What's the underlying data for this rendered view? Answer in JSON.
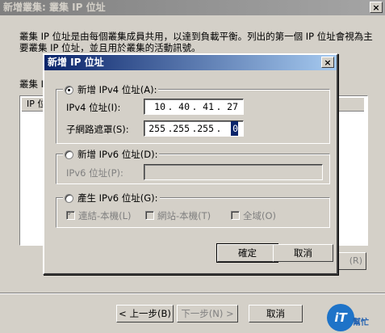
{
  "wizard": {
    "title": "新增叢集: 叢集 IP 位址",
    "close": "×",
    "description": "叢集 IP 位址是由每個叢集成員共用，以達到負載平衡。列出的第一個 IP 位址會視為主要叢集 IP 位址，並且用於叢集的活動訊號。",
    "list_label": "叢集 IP 位址(",
    "list_header": "IP 位",
    "side_button": "(R)",
    "buttons": {
      "back": "< 上一步(B)",
      "next": "下一步(N) >",
      "cancel": "取消"
    },
    "watermark": {
      "logo": "iT",
      "text": "幫忙"
    }
  },
  "dialog": {
    "title": "新增 IP 位址",
    "close": "×",
    "ipv4_group": {
      "legend": "新增 IPv4 位址(A):",
      "selected": true,
      "ip_label": "IPv4 位址(I):",
      "ip_octets": [
        "10",
        "40",
        "41",
        "27"
      ],
      "mask_label": "子網路遮罩(S):",
      "mask_octets": [
        "255",
        "255",
        "255",
        "0"
      ]
    },
    "ipv6_group": {
      "legend": "新增 IPv6 位址(D):",
      "selected": false,
      "ip_label": "IPv6 位址(P):",
      "ip_value": ""
    },
    "gen_group": {
      "legend": "產生 IPv6 位址(G):",
      "selected": false,
      "options": [
        {
          "label": "連結-本機(L)",
          "checked": true
        },
        {
          "label": "網站-本機(T)",
          "checked": false
        },
        {
          "label": "全域(O)",
          "checked": false
        }
      ]
    },
    "buttons": {
      "ok": "確定",
      "cancel": "取消"
    }
  }
}
